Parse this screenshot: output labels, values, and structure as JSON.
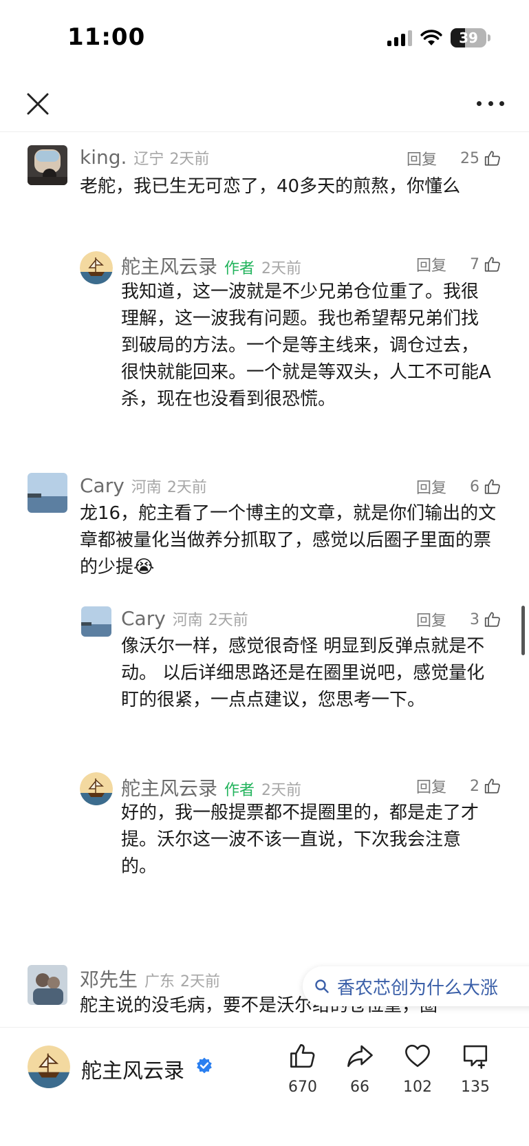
{
  "status_bar": {
    "time": "11:00",
    "battery": "39"
  },
  "comments": [
    {
      "user": "king.",
      "location": "辽宁",
      "time": "2天前",
      "reply": "回复",
      "likes": "25",
      "text": "老舵，我已生无可恋了，40多天的煎熬，你懂么"
    },
    {
      "user": "舵主风云录",
      "author_tag": "作者",
      "time": "2天前",
      "reply": "回复",
      "likes": "7",
      "text": "我知道，这一波就是不少兄弟仓位重了。我很理解，这一波我有问题。我也希望帮兄弟们找到破局的方法。一个是等主线来，调仓过去，很快就能回来。一个就是等双头，人工不可能A杀，现在也没看到很恐慌。"
    },
    {
      "user": "Cary",
      "location": "河南",
      "time": "2天前",
      "reply": "回复",
      "likes": "6",
      "text": "龙16，舵主看了一个博主的文章，就是你们输出的文章都被量化当做养分抓取了，感觉以后圈子里面的票的少提",
      "emoji": "😭"
    },
    {
      "user": "Cary",
      "location": "河南",
      "time": "2天前",
      "reply": "回复",
      "likes": "3",
      "text": "像沃尔一样，感觉很奇怪 明显到反弹点就是不动。 以后详细思路还是在圈里说吧，感觉量化盯的很紧，一点点建议，您思考一下。"
    },
    {
      "user": "舵主风云录",
      "author_tag": "作者",
      "time": "2天前",
      "reply": "回复",
      "likes": "2",
      "text": "好的，我一般提票都不提圈里的，都是走了才提。沃尔这一波不该一直说，下次我会注意的。"
    },
    {
      "user": "邓先生",
      "location": "广东",
      "time": "2天前",
      "text": "舵主说的没毛病，要不是沃尔给的仓位重，圈"
    }
  ],
  "search_pill": {
    "query": "香农芯创为什么大涨"
  },
  "bottom_bar": {
    "author": "舵主风云录",
    "like_count": "670",
    "share_count": "66",
    "favorite_count": "102",
    "comment_count": "135"
  },
  "colors": {
    "author_tag": "#21b35b",
    "search_text": "#3a5fa8",
    "verified": "#2a7ff0"
  }
}
